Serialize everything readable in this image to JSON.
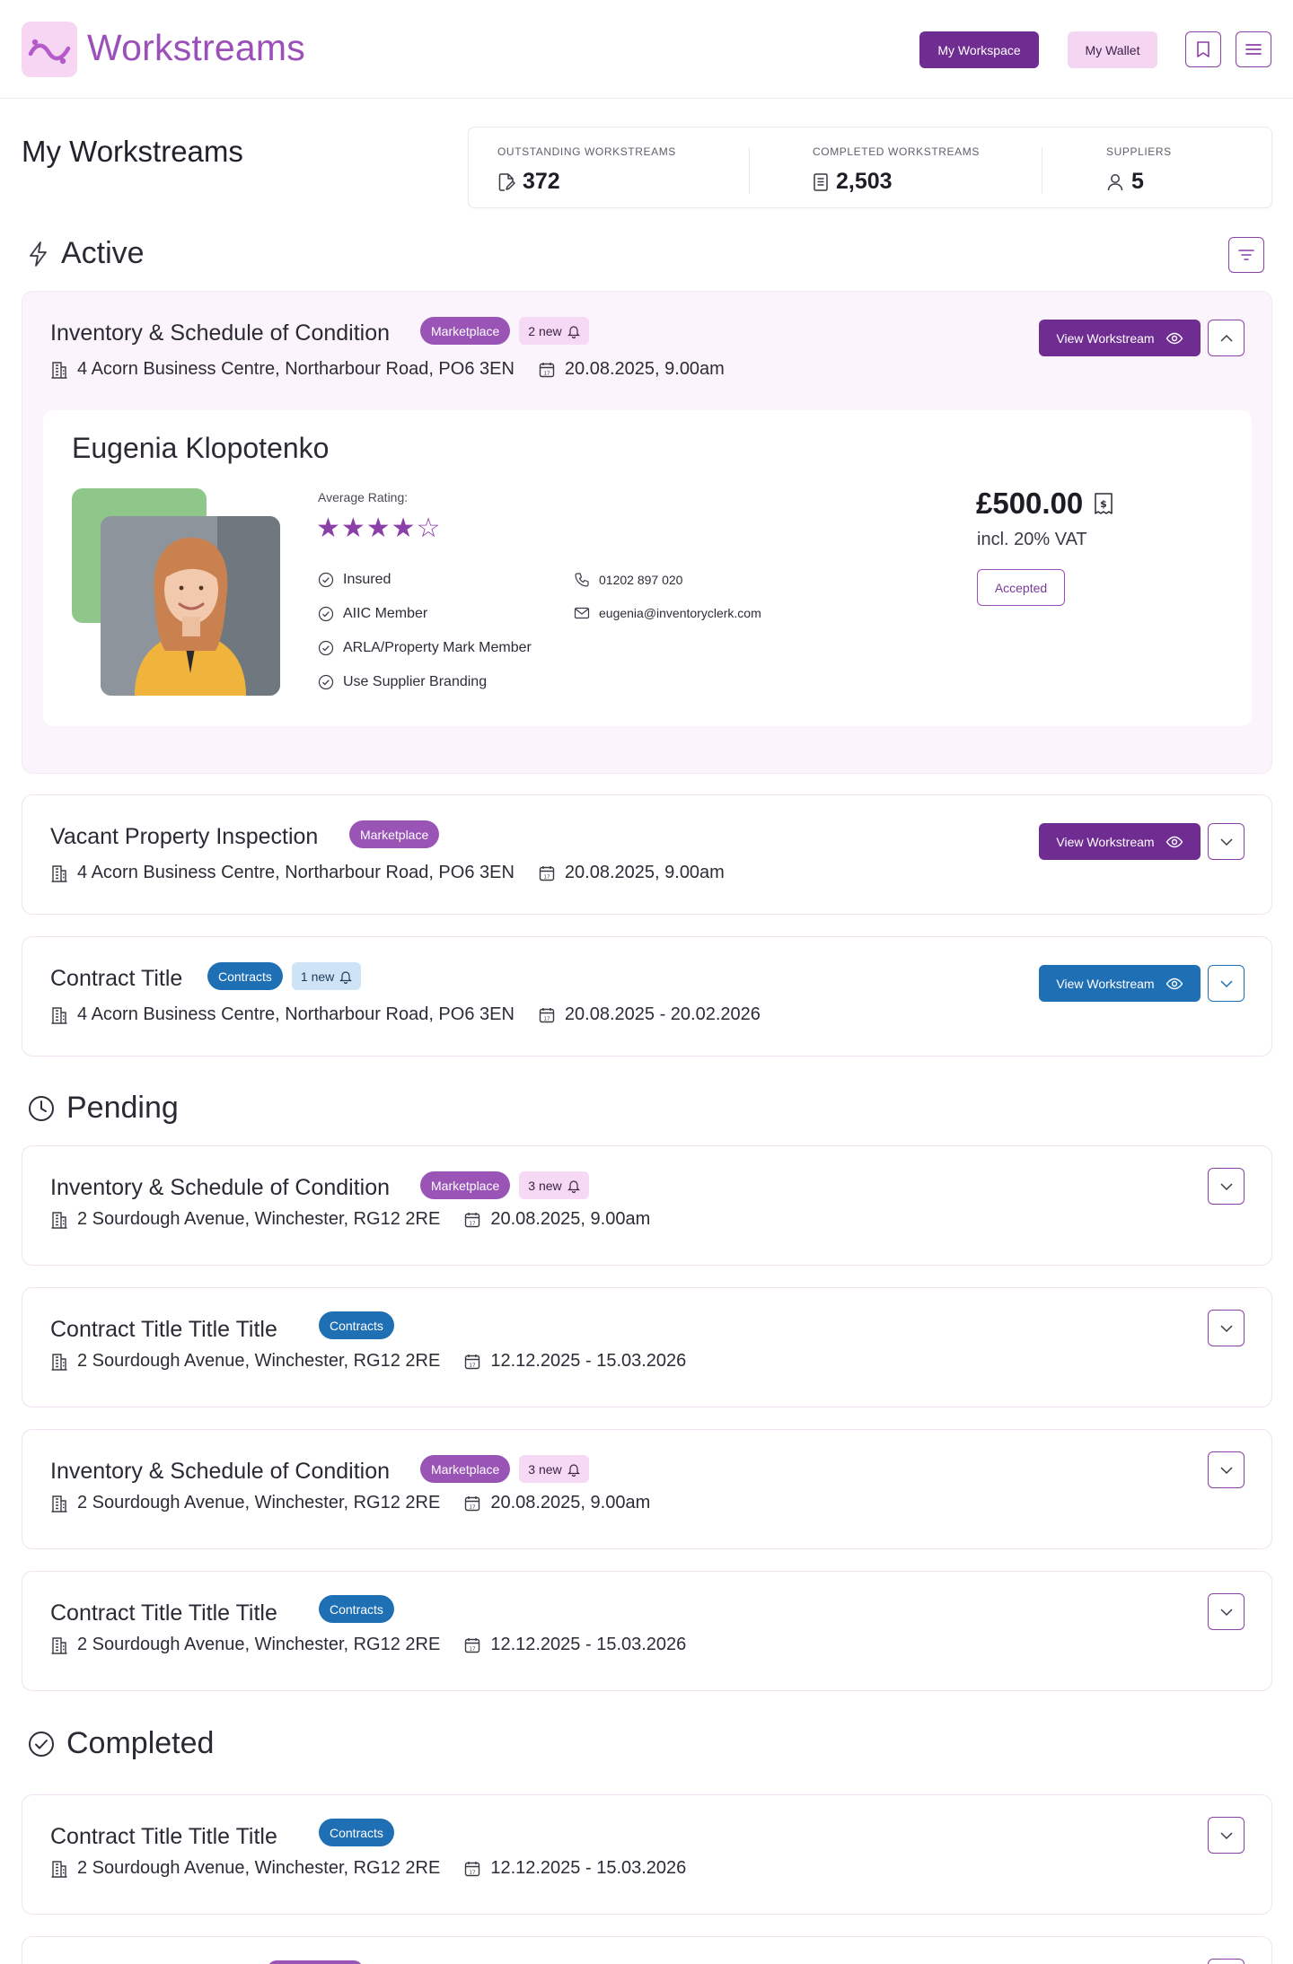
{
  "header": {
    "app_name": "Workstreams",
    "workspace_label": "My Workspace",
    "wallet_label": "My Wallet",
    "icons": [
      "bookmark-icon",
      "menu-icon"
    ]
  },
  "page": {
    "title": "My Workstreams"
  },
  "stats": [
    {
      "label": "OUTSTANDING WORKSTREAMS",
      "value": "372",
      "icon": "file-edit-icon"
    },
    {
      "label": "COMPLETED WORKSTREAMS",
      "value": "2,503",
      "icon": "document-icon"
    },
    {
      "label": "SUPPLIERS",
      "value": "5",
      "icon": "user-icon"
    }
  ],
  "sections": {
    "active": "Active",
    "pending": "Pending",
    "completed": "Completed"
  },
  "view_label": "View Workstream",
  "active_cards": [
    {
      "title": "Inventory & Schedule of Condition",
      "badge": "Marketplace",
      "new": "2 new",
      "address": "4 Acorn Business Centre, Northarbour Road, PO6 3EN",
      "date": "20.08.2025, 9.00am"
    },
    {
      "title": "Vacant Property Inspection",
      "badge": "Marketplace",
      "address": "4 Acorn Business Centre, Northarbour Road, PO6 3EN",
      "date": "20.08.2025, 9.00am"
    },
    {
      "title": "Contract Title",
      "badge": "Contracts",
      "new": "1 new",
      "address": "4 Acorn Business Centre, Northarbour Road, PO6 3EN",
      "date": "20.08.2025 - 20.02.2026"
    }
  ],
  "supplier": {
    "name": "Eugenia Klopotenko",
    "rating_label": "Average Rating:",
    "rating": 4,
    "rating_max": 5,
    "stars": "★★★★☆",
    "checks": [
      "Insured",
      "AIIC Member",
      "ARLA/Property Mark Member",
      "Use Supplier Branding"
    ],
    "phone": "01202 897 020",
    "email": "eugenia@inventoryclerk.com",
    "price": "£500.00",
    "vat": "incl. 20% VAT",
    "status": "Accepted"
  },
  "pending_cards": [
    {
      "title": "Inventory & Schedule of Condition",
      "badge": "Marketplace",
      "new": "3 new",
      "address": "2 Sourdough Avenue, Winchester, RG12 2RE",
      "date": "20.08.2025, 9.00am"
    },
    {
      "title": "Contract Title Title Title",
      "badge": "Contracts",
      "address": "2 Sourdough Avenue, Winchester, RG12 2RE",
      "date": "12.12.2025 - 15.03.2026"
    },
    {
      "title": "Inventory & Schedule of Condition",
      "badge": "Marketplace",
      "new": "3 new",
      "address": "2 Sourdough Avenue, Winchester, RG12 2RE",
      "date": "20.08.2025, 9.00am"
    },
    {
      "title": "Contract Title Title Title",
      "badge": "Contracts",
      "address": "2 Sourdough Avenue, Winchester, RG12 2RE",
      "date": "12.12.2025 - 15.03.2026"
    }
  ],
  "completed_cards": [
    {
      "title": "Contract Title Title Title",
      "badge": "Contracts",
      "address": "2 Sourdough Avenue, Winchester, RG12 2RE",
      "date": "12.12.2025 - 15.03.2026"
    }
  ],
  "colors": {
    "brand": "#9b4fb8",
    "primary": "#6f2c91",
    "contracts": "#1f6fb5",
    "marketplace": "#9954b6"
  }
}
